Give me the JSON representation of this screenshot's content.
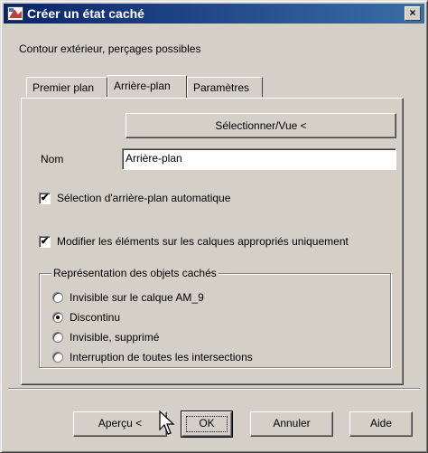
{
  "window": {
    "title": "Créer un état caché",
    "close_label": "×"
  },
  "description": "Contour extérieur, perçages possibles",
  "tabs": [
    {
      "label": "Premier plan"
    },
    {
      "label": "Arrière-plan"
    },
    {
      "label": "Paramètres"
    }
  ],
  "select_view_button": "Sélectionner/Vue <",
  "name_label": "Nom",
  "name_value": "Arrière-plan",
  "check_auto_background": {
    "label": "Sélection d'arrière-plan automatique",
    "checked": true
  },
  "check_modify_layers": {
    "label": "Modifier les éléments sur les calques appropriés uniquement",
    "checked": true
  },
  "group": {
    "title": "Représentation des objets cachés",
    "options": [
      {
        "label": "Invisible sur le calque AM_9",
        "selected": false
      },
      {
        "label": "Discontinu",
        "selected": true
      },
      {
        "label": "Invisible, supprimé",
        "selected": false
      },
      {
        "label": "Interruption de toutes les intersections",
        "selected": false
      }
    ]
  },
  "buttons": {
    "preview": "Aperçu <",
    "ok": "OK",
    "cancel": "Annuler",
    "help": "Aide"
  },
  "check_mark": "✔",
  "colors": {
    "titlebar_start": "#0a246a",
    "titlebar_end": "#3a6ea5",
    "face": "#d4d0c8"
  }
}
